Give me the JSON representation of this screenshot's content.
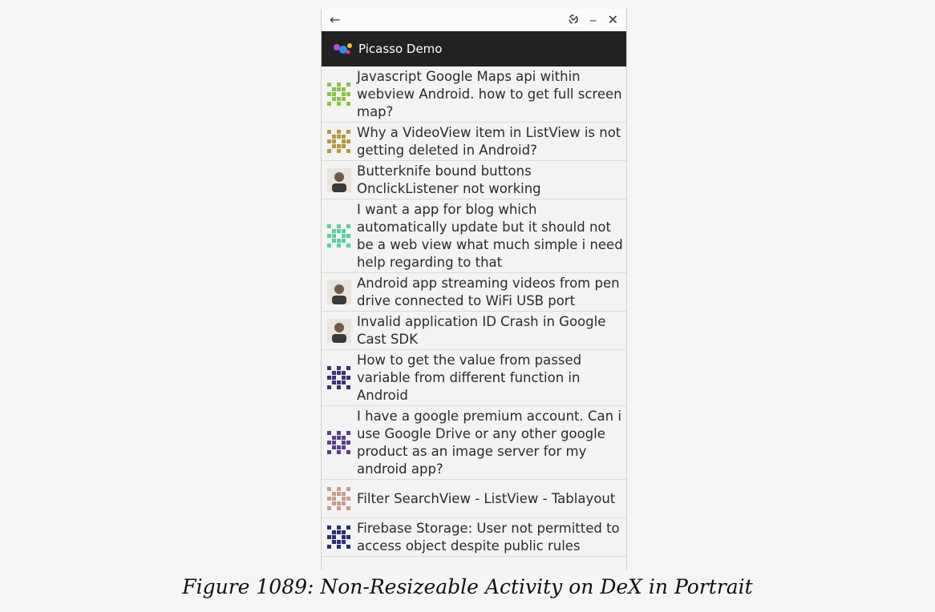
{
  "window": {
    "back_icon": "arrow-left-icon",
    "rotate_icon": "rotate-icon",
    "minimize_icon": "minimize-icon",
    "close_icon": "close-icon"
  },
  "appbar": {
    "title": "Picasso Demo",
    "icon": "picasso-logo-icon"
  },
  "list": {
    "items": [
      {
        "title": "Javascript Google Maps api within webview Android. how to get full screen map?",
        "avatar": "identicon-green"
      },
      {
        "title": "Why a VideoView item in ListView is not getting deleted in Android?",
        "avatar": "identicon-gold"
      },
      {
        "title": "Butterknife bound buttons OnclickListener not working",
        "avatar": "photo-avatar"
      },
      {
        "title": "I want a app for blog which automatically update but it should not be a web view what much simple i need help regarding to that",
        "avatar": "identicon-mint"
      },
      {
        "title": "Android app streaming videos from pen drive connected to WiFi USB port",
        "avatar": "photo-avatar"
      },
      {
        "title": "Invalid application ID Crash in Google Cast SDK",
        "avatar": "photo-avatar"
      },
      {
        "title": "How to get the value from passed variable from different function in Android",
        "avatar": "identicon-indigo"
      },
      {
        "title": "I have a google premium account. Can i use Google Drive or any other google product as an image server for my android app?",
        "avatar": "identicon-purple"
      },
      {
        "title": "Filter SearchView - ListView - Tablayout",
        "avatar": "identicon-rose"
      },
      {
        "title": "Firebase Storage: User not permitted to access object despite public rules",
        "avatar": "identicon-navy"
      }
    ]
  },
  "caption": "Figure 1089: Non-Resizeable Activity on DeX in Portrait"
}
